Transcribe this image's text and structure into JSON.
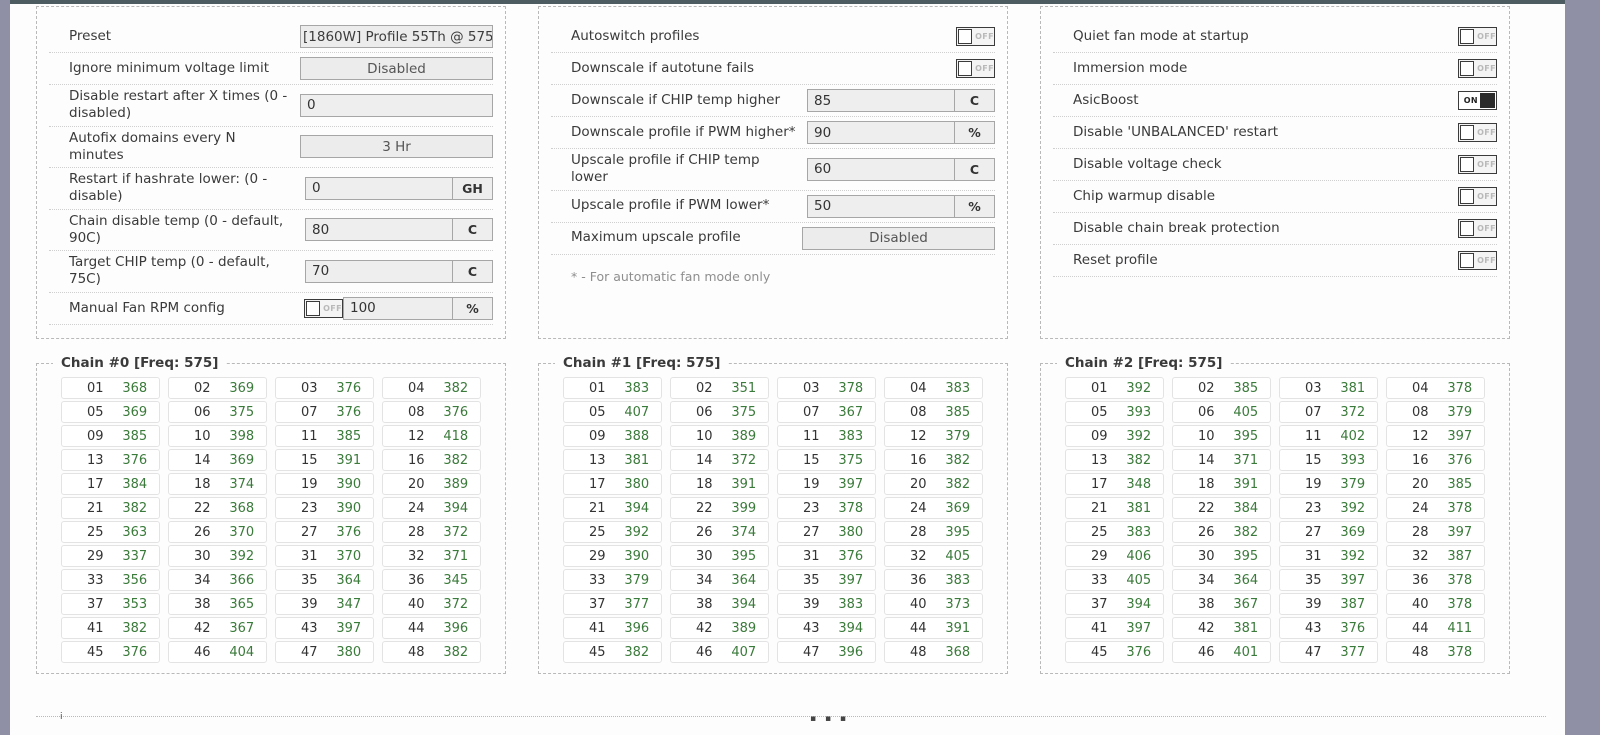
{
  "colors": {
    "accent_green": "#3a7a3a",
    "topbar": "#4c5c60",
    "page_bg": "#8f8fa6",
    "panel_bg": "#fdfdfe"
  },
  "panel_left": {
    "rows": [
      {
        "label": "Preset",
        "type": "select",
        "value": "[1860W] Profile 55Th @ 575",
        "align": "left"
      },
      {
        "label": "Ignore minimum voltage limit",
        "type": "select",
        "value": "Disabled",
        "align": "center"
      },
      {
        "label": "Disable restart after X times (0 - disabled)",
        "type": "input",
        "value": "0"
      },
      {
        "label": "Autofix domains every N minutes",
        "type": "select",
        "value": "3 Hr",
        "align": "center"
      },
      {
        "label": "Restart if hashrate lower: (0 - disable)",
        "type": "input-unit",
        "value": "0",
        "unit": "GH"
      },
      {
        "label": "Chain disable temp (0 - default, 90C)",
        "type": "input-unit",
        "value": "80",
        "unit": "C"
      },
      {
        "label": "Target CHIP temp (0 - default, 75C)",
        "type": "input-unit",
        "value": "70",
        "unit": "C"
      },
      {
        "label": "Manual Fan RPM config",
        "type": "toggle-input-unit",
        "toggle": "OFF",
        "value": "100",
        "unit": "%"
      }
    ]
  },
  "panel_middle": {
    "rows": [
      {
        "label": "Autoswitch profiles",
        "type": "toggle",
        "toggle": "OFF"
      },
      {
        "label": "Downscale if autotune fails",
        "type": "toggle",
        "toggle": "OFF"
      },
      {
        "label": "Downscale if CHIP temp higher",
        "type": "input-unit",
        "value": "85",
        "unit": "C"
      },
      {
        "label": "Downscale profile if PWM higher*",
        "type": "input-unit",
        "value": "90",
        "unit": "%"
      },
      {
        "label": "Upscale profile if CHIP temp lower",
        "type": "input-unit",
        "value": "60",
        "unit": "C"
      },
      {
        "label": "Upscale profile if PWM lower*",
        "type": "input-unit",
        "value": "50",
        "unit": "%"
      },
      {
        "label": "Maximum upscale profile",
        "type": "select",
        "value": "Disabled",
        "align": "center"
      }
    ],
    "footnote": "* - For automatic fan mode only"
  },
  "panel_right": {
    "rows": [
      {
        "label": "Quiet fan mode at startup",
        "type": "toggle",
        "toggle": "OFF"
      },
      {
        "label": "Immersion mode",
        "type": "toggle",
        "toggle": "OFF"
      },
      {
        "label": "AsicBoost",
        "type": "toggle",
        "toggle": "ON"
      },
      {
        "label": "Disable 'UNBALANCED' restart",
        "type": "toggle",
        "toggle": "OFF"
      },
      {
        "label": "Disable voltage check",
        "type": "toggle",
        "toggle": "OFF"
      },
      {
        "label": "Chip warmup disable",
        "type": "toggle",
        "toggle": "OFF"
      },
      {
        "label": "Disable chain break protection",
        "type": "toggle",
        "toggle": "OFF"
      },
      {
        "label": "Reset profile",
        "type": "toggle",
        "toggle": "OFF"
      }
    ]
  },
  "chains": [
    {
      "title": "Chain #0 [Freq: 575]",
      "freq": 575,
      "indices": [
        "01",
        "02",
        "03",
        "04",
        "05",
        "06",
        "07",
        "08",
        "09",
        "10",
        "11",
        "12",
        "13",
        "14",
        "15",
        "16",
        "17",
        "18",
        "19",
        "20",
        "21",
        "22",
        "23",
        "24",
        "25",
        "26",
        "27",
        "28",
        "29",
        "30",
        "31",
        "32",
        "33",
        "34",
        "35",
        "36",
        "37",
        "38",
        "39",
        "40",
        "41",
        "42",
        "43",
        "44",
        "45",
        "46",
        "47",
        "48"
      ],
      "values": [
        368,
        369,
        376,
        382,
        369,
        375,
        376,
        376,
        385,
        398,
        385,
        418,
        376,
        369,
        391,
        382,
        384,
        374,
        390,
        389,
        382,
        368,
        390,
        394,
        363,
        370,
        376,
        372,
        337,
        392,
        370,
        371,
        356,
        366,
        364,
        345,
        353,
        365,
        347,
        372,
        382,
        367,
        397,
        396,
        376,
        404,
        380,
        382
      ]
    },
    {
      "title": "Chain #1 [Freq: 575]",
      "freq": 575,
      "indices": [
        "01",
        "02",
        "03",
        "04",
        "05",
        "06",
        "07",
        "08",
        "09",
        "10",
        "11",
        "12",
        "13",
        "14",
        "15",
        "16",
        "17",
        "18",
        "19",
        "20",
        "21",
        "22",
        "23",
        "24",
        "25",
        "26",
        "27",
        "28",
        "29",
        "30",
        "31",
        "32",
        "33",
        "34",
        "35",
        "36",
        "37",
        "38",
        "39",
        "40",
        "41",
        "42",
        "43",
        "44",
        "45",
        "46",
        "47",
        "48"
      ],
      "values": [
        383,
        351,
        378,
        383,
        407,
        375,
        367,
        385,
        388,
        389,
        383,
        379,
        381,
        372,
        375,
        382,
        380,
        391,
        397,
        382,
        394,
        399,
        378,
        369,
        392,
        374,
        380,
        395,
        390,
        395,
        376,
        405,
        379,
        364,
        397,
        383,
        377,
        394,
        383,
        373,
        396,
        389,
        394,
        391,
        382,
        407,
        396,
        368
      ]
    },
    {
      "title": "Chain #2 [Freq: 575]",
      "freq": 575,
      "indices": [
        "01",
        "02",
        "03",
        "04",
        "05",
        "06",
        "07",
        "08",
        "09",
        "10",
        "11",
        "12",
        "13",
        "14",
        "15",
        "16",
        "17",
        "18",
        "19",
        "20",
        "21",
        "22",
        "23",
        "24",
        "25",
        "26",
        "27",
        "28",
        "29",
        "30",
        "31",
        "32",
        "33",
        "34",
        "35",
        "36",
        "37",
        "38",
        "39",
        "40",
        "41",
        "42",
        "43",
        "44",
        "45",
        "46",
        "47",
        "48"
      ],
      "values": [
        392,
        385,
        381,
        378,
        393,
        405,
        372,
        379,
        392,
        395,
        402,
        397,
        382,
        371,
        393,
        376,
        348,
        391,
        379,
        385,
        381,
        384,
        392,
        378,
        383,
        382,
        369,
        397,
        406,
        395,
        392,
        387,
        405,
        364,
        397,
        378,
        394,
        367,
        387,
        378,
        397,
        381,
        376,
        411,
        376,
        401,
        377,
        378
      ]
    }
  ]
}
